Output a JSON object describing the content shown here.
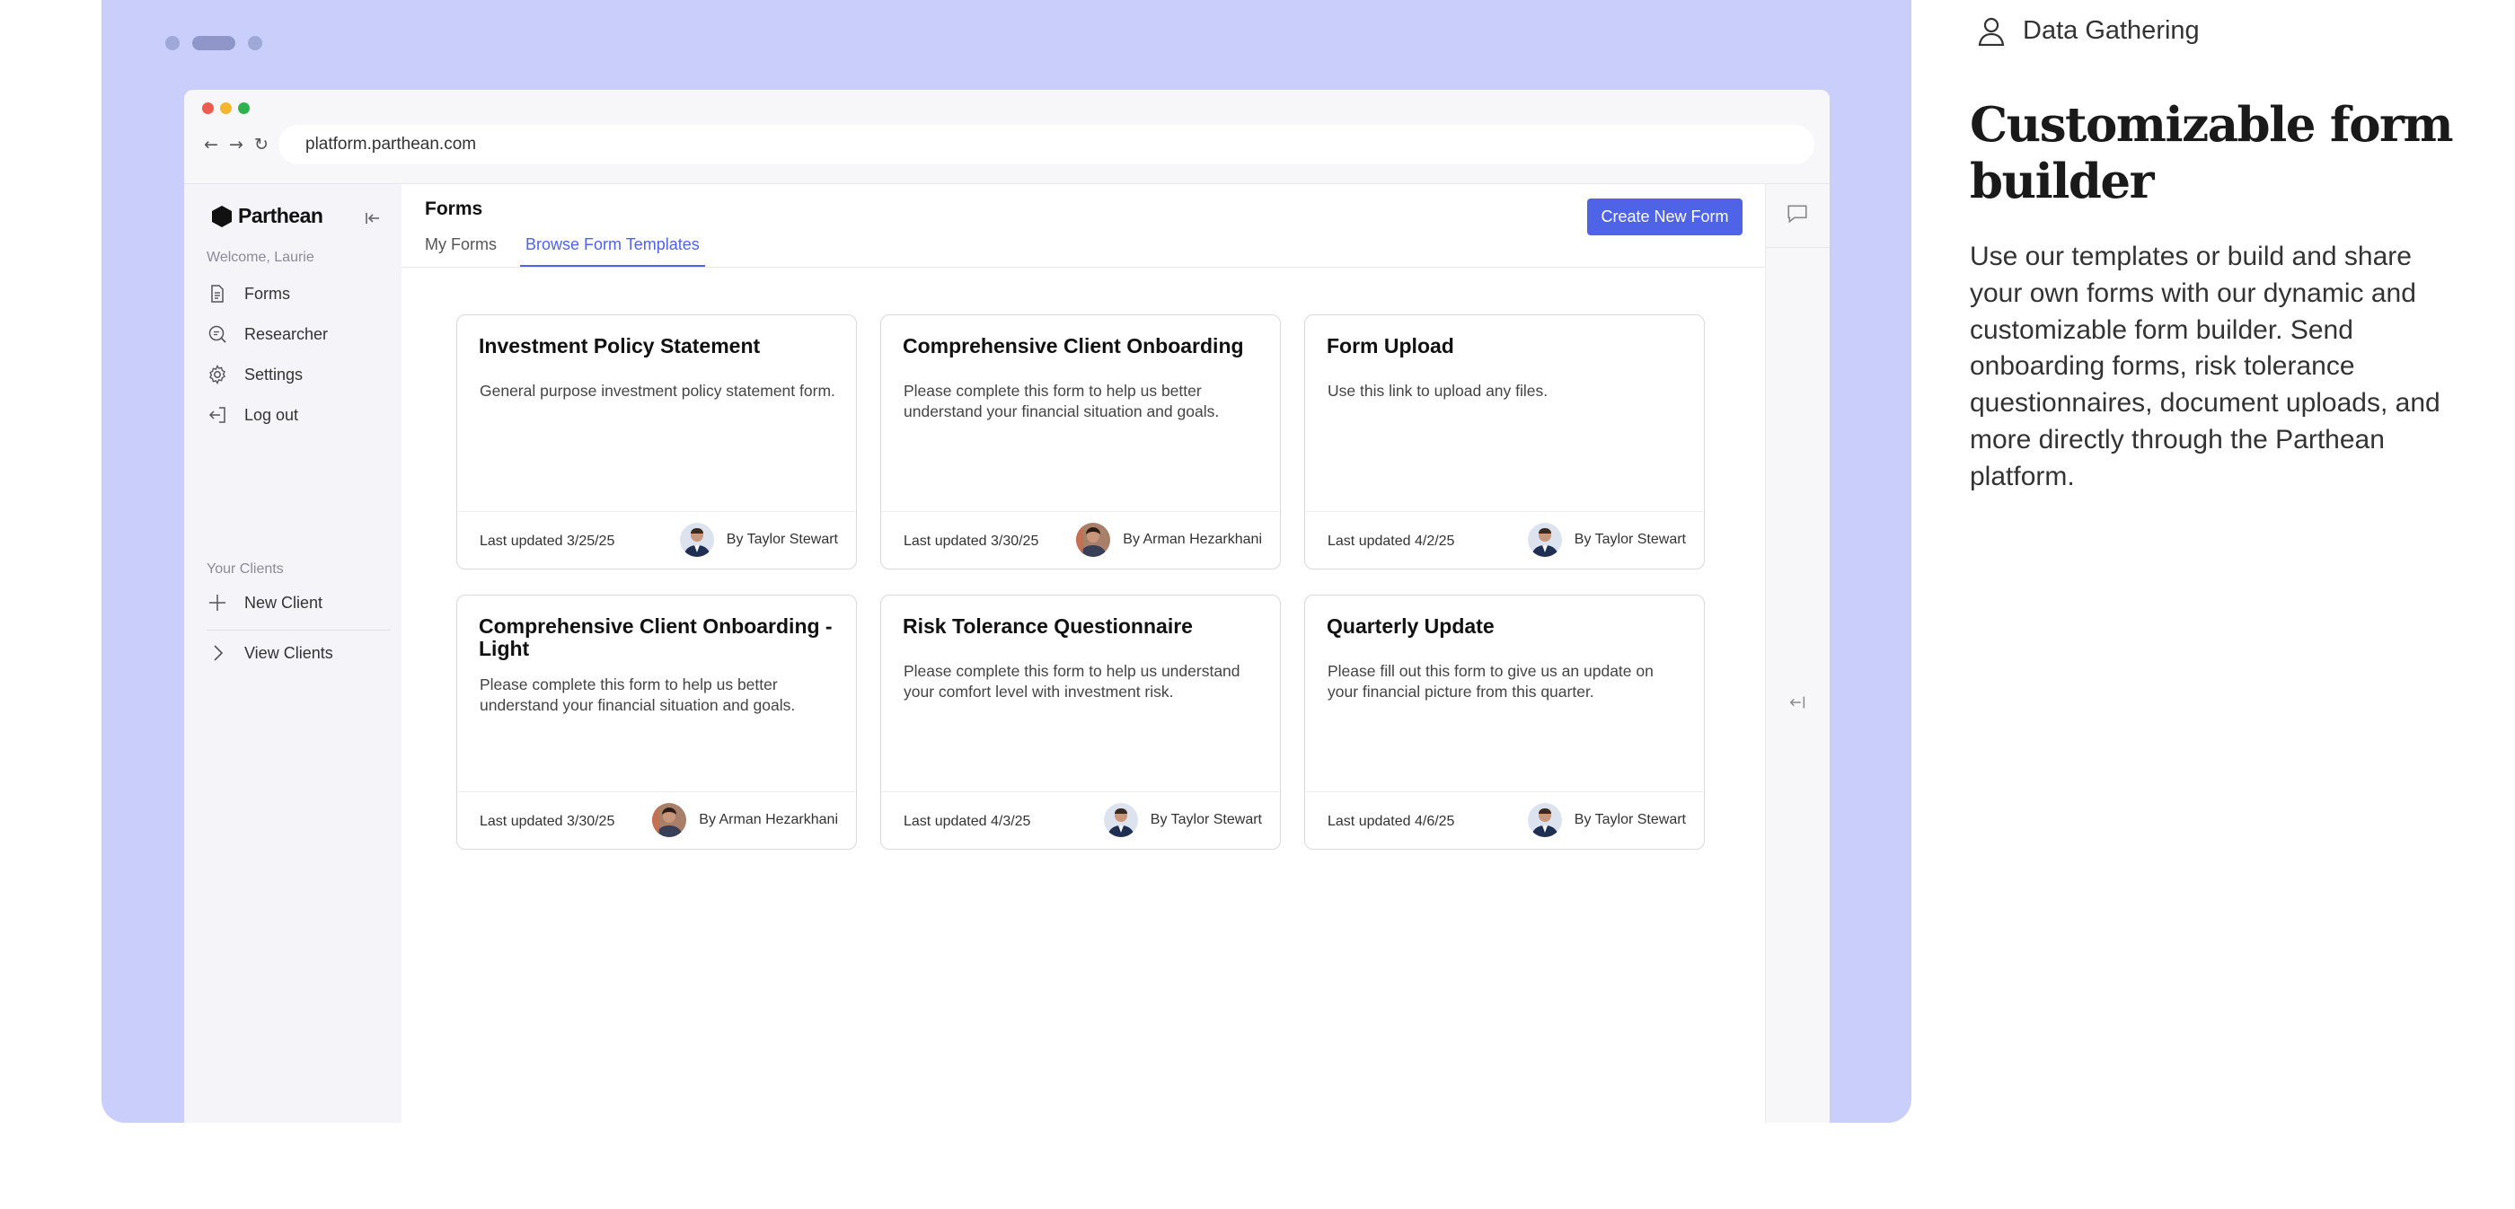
{
  "browser": {
    "url": "platform.parthean.com"
  },
  "sidebar": {
    "brand": "Parthean",
    "welcome": "Welcome, Laurie",
    "items": [
      {
        "label": "Forms",
        "icon": "document-icon"
      },
      {
        "label": "Researcher",
        "icon": "search-document-icon"
      },
      {
        "label": "Settings",
        "icon": "gear-icon"
      },
      {
        "label": "Log out",
        "icon": "logout-icon"
      }
    ],
    "clients_section": "Your Clients",
    "client_items": [
      {
        "label": "New Client",
        "icon": "plus-icon"
      },
      {
        "label": "View Clients",
        "icon": "chevron-right-icon"
      }
    ]
  },
  "main": {
    "title": "Forms",
    "tabs": [
      {
        "label": "My Forms",
        "active": false
      },
      {
        "label": "Browse Form Templates",
        "active": true
      }
    ],
    "create_button": "Create New Form",
    "cards": [
      {
        "title": "Investment Policy Statement",
        "description": "General purpose investment policy statement form.",
        "updated": "Last updated 3/25/25",
        "author": "By Taylor Stewart"
      },
      {
        "title": "Comprehensive Client Onboarding",
        "description": "Please complete this form to help us better understand your financial situation and goals.",
        "updated": "Last updated 3/30/25",
        "author": "By Arman Hezarkhani"
      },
      {
        "title": "Form Upload",
        "description": "Use this link to upload any files.",
        "updated": "Last updated 4/2/25",
        "author": "By Taylor Stewart"
      },
      {
        "title": "Comprehensive Client Onboarding - Light",
        "description": "Please complete this form to help us better understand your financial situation and goals.",
        "updated": "Last updated 3/30/25",
        "author": "By Arman Hezarkhani"
      },
      {
        "title": "Risk Tolerance Questionnaire",
        "description": "Please complete this form to help us understand your comfort level with investment risk.",
        "updated": "Last updated 4/3/25",
        "author": "By Taylor Stewart"
      },
      {
        "title": "Quarterly Update",
        "description": "Please fill out this form to give us an update on your financial picture from this quarter.",
        "updated": "Last updated 4/6/25",
        "author": "By Taylor Stewart"
      }
    ]
  },
  "feature": {
    "eyebrow": "Data Gathering",
    "heading": "Customizable form builder",
    "body": "Use our templates or build and share your own forms with our dynamic and customizable form builder. Send onboarding forms, risk tolerance questionnaires, document uploads, and more directly through the Parthean platform."
  },
  "colors": {
    "panel": "#c9cffa",
    "accent": "#4f63e6",
    "sidebar": "#f5f4f9"
  }
}
